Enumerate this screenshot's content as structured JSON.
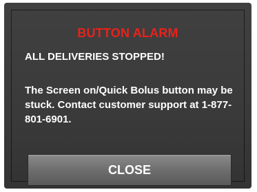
{
  "alarm": {
    "title": "BUTTON ALARM",
    "headline": "ALL DELIVERIES STOPPED!",
    "message": "The Screen on/Quick Bolus button may be stuck. Contact customer support at 1-877-801-6901.",
    "close_label": "CLOSE"
  },
  "colors": {
    "title_red": "#e8221c",
    "background": "#3a3a3a",
    "text": "#ffffff",
    "button": "#6e6e6e"
  }
}
